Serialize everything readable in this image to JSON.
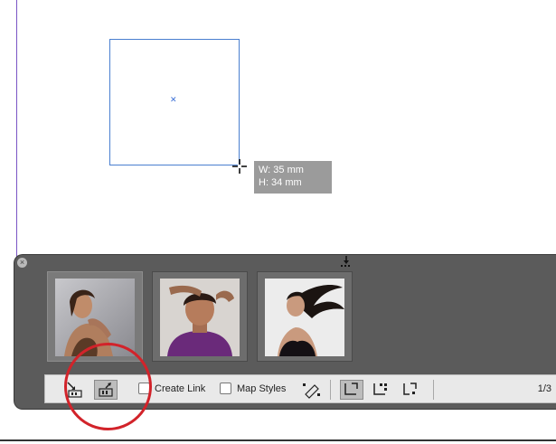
{
  "tooltip": {
    "width_label": "W: 35 mm",
    "height_label": "H: 34 mm"
  },
  "panel": {
    "thumbnails": [
      {
        "name": "woman-photo-1",
        "selected": true
      },
      {
        "name": "woman-photo-2",
        "selected": false
      },
      {
        "name": "woman-photo-3",
        "selected": false
      }
    ],
    "toolbar": {
      "create_link_label": "Create Link",
      "create_link_checked": false,
      "map_styles_label": "Map Styles",
      "map_styles_checked": false,
      "page_count": "1/3"
    }
  },
  "colors": {
    "frame": "#4a7fd0",
    "annotation": "#d2232a",
    "panel_bg": "#5b5b5b"
  }
}
